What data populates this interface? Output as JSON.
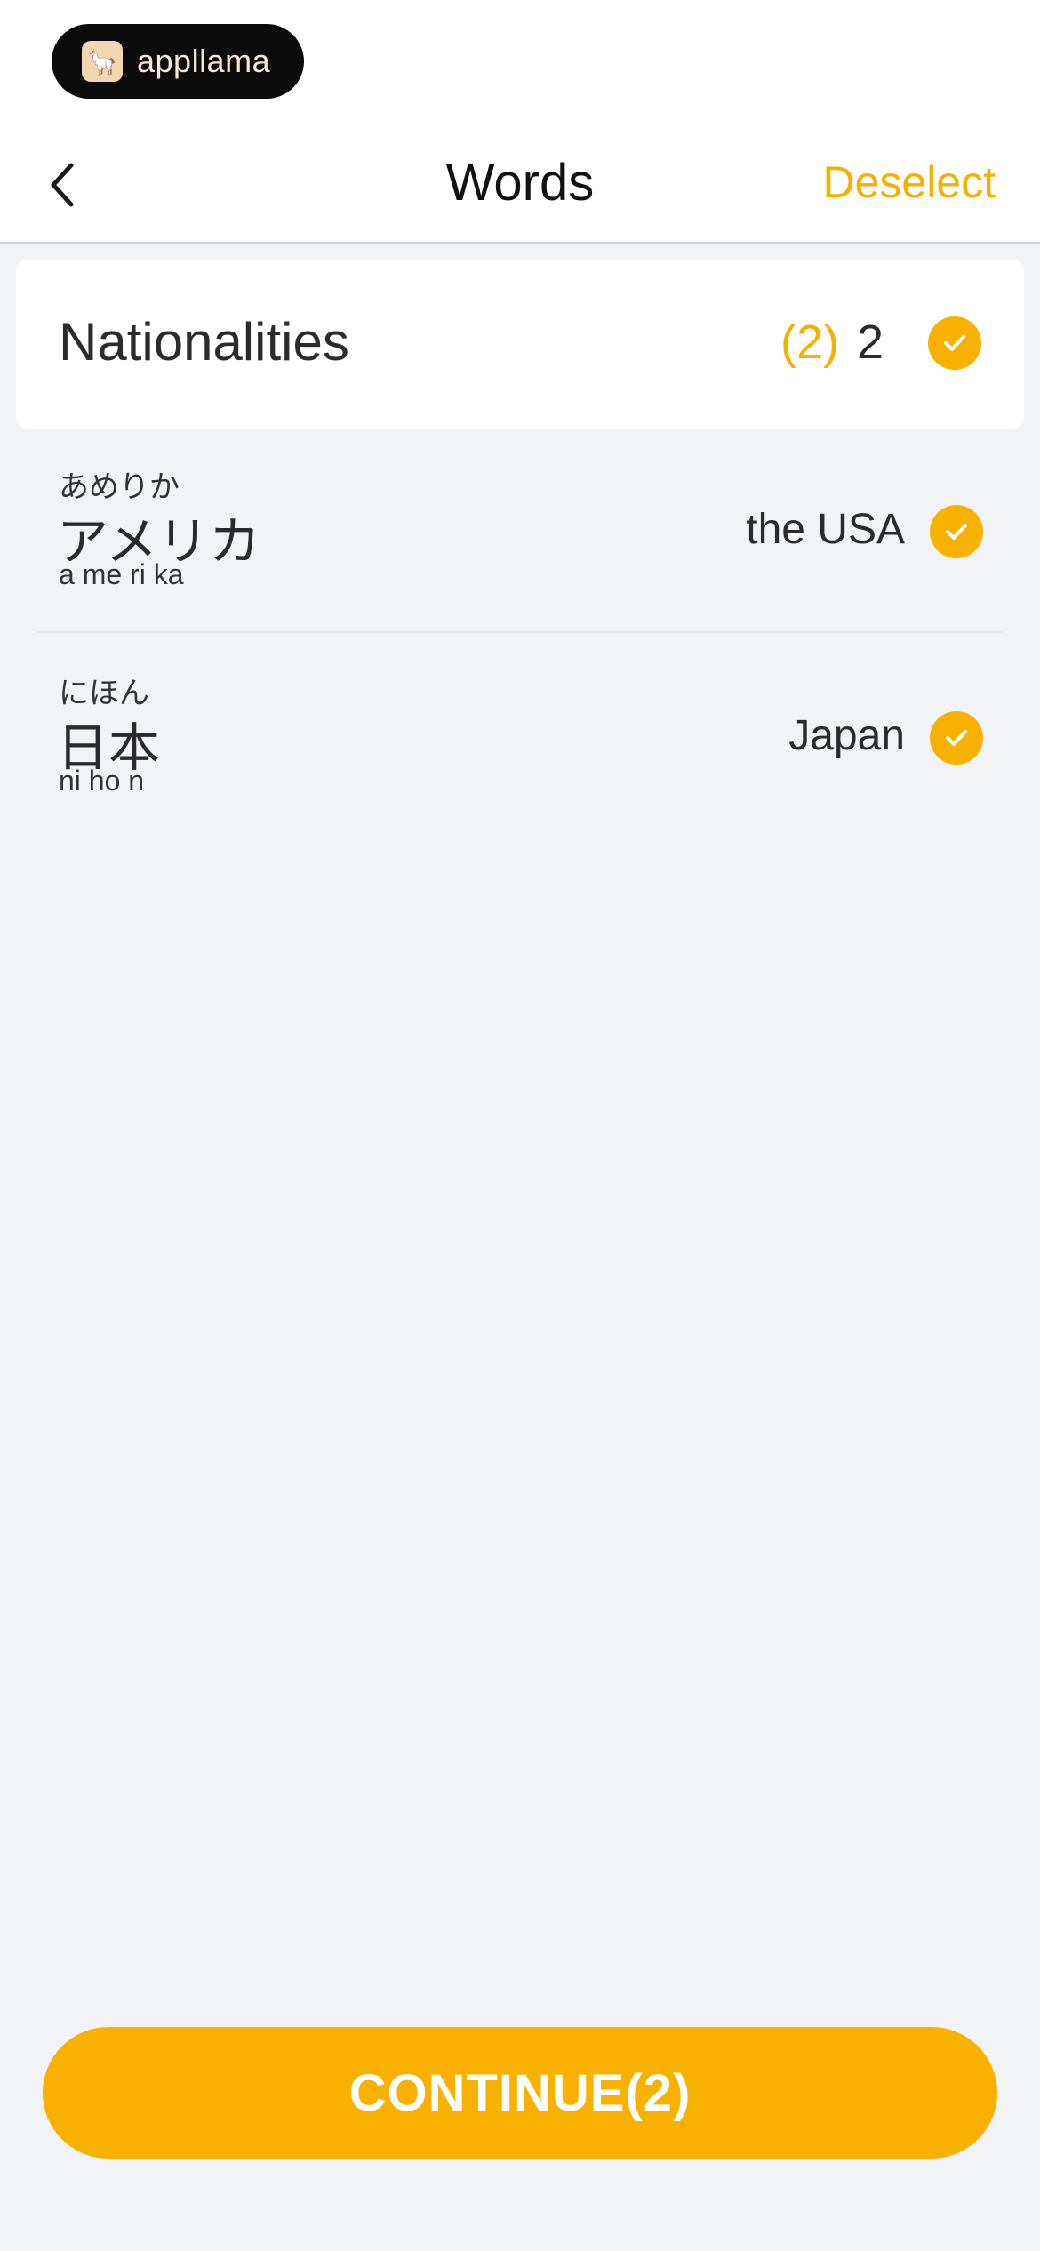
{
  "app_badge": {
    "label": "appllama",
    "icon": "llama-icon"
  },
  "header": {
    "title": "Words",
    "deselect_label": "Deselect",
    "back_icon": "chevron-left-icon"
  },
  "category": {
    "title": "Nationalities",
    "selected_count": "(2)",
    "total_count": "2",
    "check_icon": "checkmark-icon"
  },
  "words": [
    {
      "kana": "あめりか",
      "kanji": "アメリカ",
      "romaji": "a me ri ka",
      "translation": "the USA",
      "selected": true
    },
    {
      "kana": "にほん",
      "kanji": "日本",
      "romaji": "ni ho n",
      "translation": "Japan",
      "selected": true
    }
  ],
  "continue_label": "CONTINUE(2)",
  "colors": {
    "accent": "#F7B100",
    "background": "#F2F3F7",
    "text": "#2B2B2B"
  }
}
